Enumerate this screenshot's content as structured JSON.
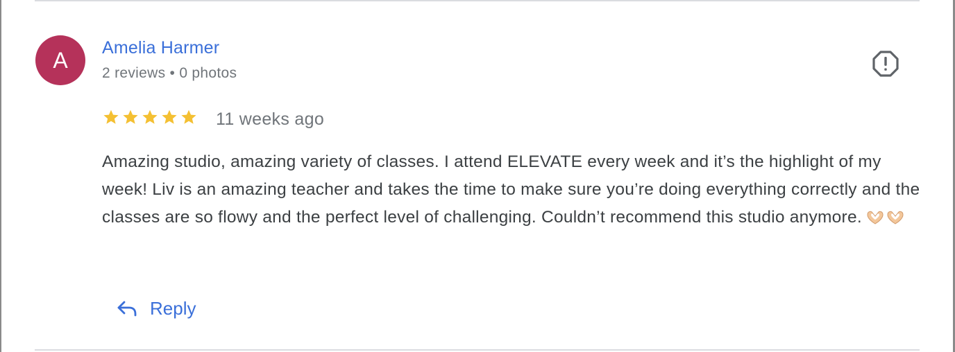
{
  "reviewer": {
    "avatar_letter": "A",
    "avatar_color": "#b5325a",
    "name": "Amelia Harmer",
    "meta": "2 reviews • 0 photos"
  },
  "review": {
    "rating": 5,
    "max_rating": 5,
    "star_color": "#f4c033",
    "date": "11 weeks ago",
    "text": "Amazing studio, amazing variety of classes. I attend ELEVATE every week and it’s the highlight of my week! Liv is an amazing teacher and takes the time to make sure you’re doing everything correctly and the classes are so flowy and the perfect level of challenging. Couldn’t recommend this studio anymore.",
    "emoji_icons": [
      "heart-hands-icon",
      "heart-hands-icon"
    ]
  },
  "actions": {
    "reply_label": "Reply",
    "reply_icon": "reply-arrow-icon",
    "flag_icon": "report-flag-icon"
  },
  "colors": {
    "accent": "#3a6fd9",
    "text": "#3c4043",
    "secondary_text": "#70757a",
    "divider": "#dadce0"
  }
}
